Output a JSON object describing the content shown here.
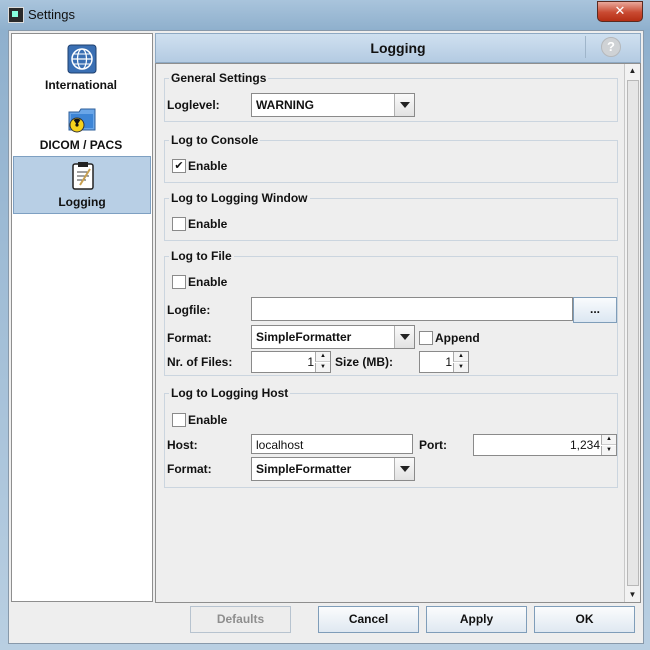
{
  "window": {
    "title": "Settings",
    "close_glyph": "✕"
  },
  "sidebar": {
    "items": [
      {
        "label": "International",
        "icon": "globe-icon"
      },
      {
        "label": "DICOM / PACS",
        "icon": "radiation-folder-icon"
      },
      {
        "label": "Logging",
        "icon": "clipboard-icon",
        "selected": true
      }
    ]
  },
  "header": {
    "title": "Logging",
    "help_glyph": "?"
  },
  "general": {
    "legend": "General Settings",
    "loglevel_label": "Loglevel:",
    "loglevel_value": "WARNING"
  },
  "console": {
    "legend": "Log to Console",
    "enable_label": "Enable",
    "enabled": true
  },
  "logwindow": {
    "legend": "Log to Logging Window",
    "enable_label": "Enable",
    "enabled": false
  },
  "file": {
    "legend": "Log to File",
    "enable_label": "Enable",
    "enabled": false,
    "logfile_label": "Logfile:",
    "logfile_value": "",
    "browse_label": "...",
    "format_label": "Format:",
    "format_value": "SimpleFormatter",
    "append_label": "Append",
    "append": false,
    "nfiles_label": "Nr. of Files:",
    "nfiles_value": "1",
    "size_label": "Size (MB):",
    "size_value": "1"
  },
  "host": {
    "legend": "Log to Logging Host",
    "enable_label": "Enable",
    "enabled": false,
    "host_label": "Host:",
    "host_value": "localhost",
    "port_label": "Port:",
    "port_value": "1,234",
    "format_label": "Format:",
    "format_value": "SimpleFormatter"
  },
  "buttons": {
    "defaults": "Defaults",
    "cancel": "Cancel",
    "apply": "Apply",
    "ok": "OK"
  },
  "colors": {
    "selection": "#b8cfe5",
    "header": "#b4cbe2",
    "close": "#c94a31"
  }
}
